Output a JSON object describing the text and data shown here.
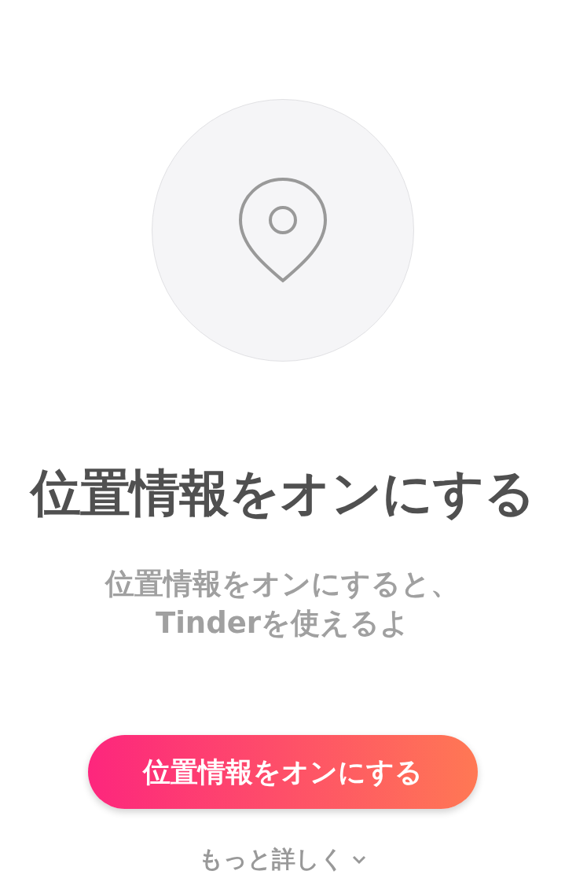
{
  "title": "位置情報をオンにする",
  "description": "位置情報をオンにすると、\nTinderを使えるよ",
  "primary_button": {
    "label": "位置情報をオンにする"
  },
  "more_link": {
    "label": "もっと詳しく"
  }
}
